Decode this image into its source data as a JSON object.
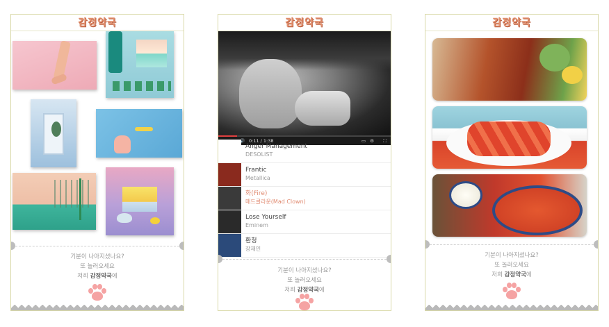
{
  "cards": [
    {
      "title": "감정약국",
      "footer": {
        "line1": "기분이 나아지셨나요?",
        "line2": "또 놀러오세요",
        "line3_prefix": "저희 ",
        "brand": "감정약국",
        "line3_suffix": "에"
      }
    },
    {
      "title": "감정약국",
      "video": {
        "time": "0:11 / 1:38",
        "progress": 0.11
      },
      "playlist": [
        {
          "name": "Anger Management",
          "artist": "DESOLIST",
          "active": false,
          "thumb_color": "#ffffff"
        },
        {
          "name": "Frantic",
          "artist": "Metallica",
          "active": false,
          "thumb_color": "#8a2a1e"
        },
        {
          "name": "화(Fire)",
          "artist": "매드클라운(Mad Clown)",
          "active": true,
          "thumb_color": "#3a3a3a"
        },
        {
          "name": "Lose Yourself",
          "artist": "Eminem",
          "active": false,
          "thumb_color": "#2a2a2a"
        },
        {
          "name": "환청",
          "artist": "장재인",
          "active": false,
          "thumb_color": "#2b4a7a"
        }
      ],
      "footer": {
        "line1": "기분이 나아지셨나요?",
        "line2": "또 놀러오세요",
        "line3_prefix": "저희 ",
        "brand": "감정약국",
        "line3_suffix": "에"
      }
    },
    {
      "title": "감정약국",
      "footer": {
        "line1": "기분이 나아지셨나요?",
        "line2": "또 놀러오세요",
        "line3_prefix": "저희 ",
        "brand": "감정약국",
        "line3_suffix": "에"
      }
    }
  ],
  "icons": {
    "play": "▶",
    "next": "⏭",
    "volume": "🔊",
    "cc": "▭",
    "settings": "⚙",
    "fullscreen": "⛶"
  }
}
